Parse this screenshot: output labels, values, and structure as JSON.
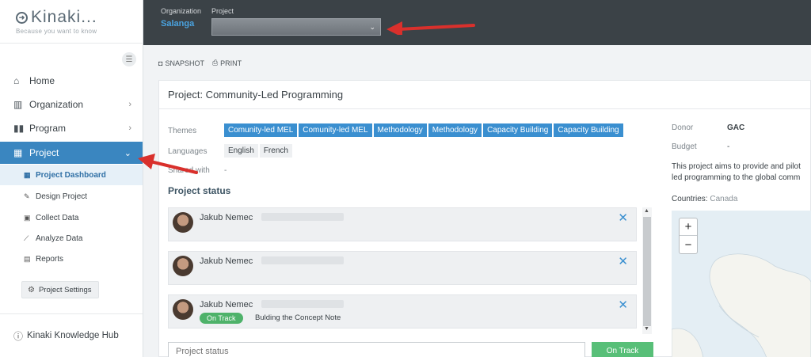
{
  "app": {
    "logo_text": "Kinaki...",
    "tagline": "Because you want to know"
  },
  "sidebar": {
    "items": [
      {
        "label": "Home"
      },
      {
        "label": "Organization"
      },
      {
        "label": "Program"
      },
      {
        "label": "Project"
      }
    ],
    "subitems": [
      {
        "label": "Project Dashboard"
      },
      {
        "label": "Design Project"
      },
      {
        "label": "Collect Data"
      },
      {
        "label": "Analyze Data"
      },
      {
        "label": "Reports"
      }
    ],
    "settings_label": "Project Settings",
    "hub_label": "Kinaki Knowledge Hub"
  },
  "topbar": {
    "org_label": "Organization",
    "project_label": "Project",
    "org_value": "Salanga"
  },
  "toolbar": {
    "snapshot": "SNAPSHOT",
    "print": "PRINT"
  },
  "project": {
    "title": "Project: Community-Led Programming",
    "themes_label": "Themes",
    "themes": [
      "Comunity-led MEL",
      "Comunity-led MEL",
      "Methodology",
      "Methodology",
      "Capacity Building",
      "Capacity Building"
    ],
    "languages_label": "Languages",
    "languages": [
      "English",
      "French"
    ],
    "shared_label": "Shared with",
    "shared_value": "-",
    "status_heading": "Project status",
    "status_cards": [
      {
        "name": "Jakub Nemec"
      },
      {
        "name": "Jakub Nemec"
      },
      {
        "name": "Jakub Nemec",
        "badge": "On Track",
        "note": "Bulding the Concept Note"
      }
    ],
    "status_placeholder": "Project status",
    "status_button": "On Track",
    "donor_label": "Donor",
    "donor_value": "GAC",
    "budget_label": "Budget",
    "budget_value": "-",
    "description_line1": "This project aims to provide and pilot",
    "description_line2": "led programming to the global comm",
    "countries_label": "Countries:",
    "countries_value": "Canada",
    "zoom_in": "+",
    "zoom_out": "−"
  },
  "colors": {
    "accent": "#3a86c0",
    "topbar": "#3b4247",
    "on_track": "#4eb26a",
    "annotation_arrow": "#d9302c"
  }
}
